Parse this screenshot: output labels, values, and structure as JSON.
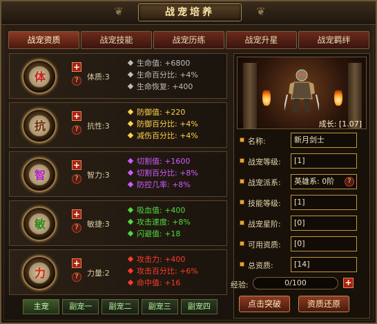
{
  "title": "战宠培养",
  "tabs": [
    "战宠资质",
    "战宠技能",
    "战宠历练",
    "战宠升星",
    "战宠羁绊"
  ],
  "attributes": [
    {
      "char": "体",
      "char_color": "#c8202a",
      "name": "体质:3",
      "stat_color": "#bdbdbd",
      "stats": [
        "生命值: +6800",
        "生命百分比: +4%",
        "生命恢复: +400"
      ]
    },
    {
      "char": "抗",
      "char_color": "#6b2a10",
      "name": "抗性:3",
      "stat_color": "#ffd24a",
      "stats": [
        "防御值: +220",
        "防御百分比: +4%",
        "减伤百分比: +4%"
      ]
    },
    {
      "char": "智",
      "char_color": "#b21fc9",
      "name": "智力:3",
      "stat_color": "#cf5bff",
      "stats": [
        "切割值: +1600",
        "切割百分比: +8%",
        "防控几率: +8%"
      ]
    },
    {
      "char": "敏",
      "char_color": "#2f8a1c",
      "name": "敏捷:3",
      "stat_color": "#4edb3e",
      "stats": [
        "吸血值: +400",
        "攻击速度: +8%",
        "闪避值: +18"
      ]
    },
    {
      "char": "力",
      "char_color": "#d8231b",
      "name": "力量:2",
      "stat_color": "#ff3a2a",
      "stats": [
        "攻击力: +400",
        "攻击百分比: +6%",
        "命中值: +16"
      ]
    }
  ],
  "bottom_tabs": [
    "主宠",
    "副宠一",
    "副宠二",
    "副宠三",
    "副宠四"
  ],
  "growth": "成长: [1.07]",
  "info": [
    {
      "label": "名称:",
      "value": "新月剑士"
    },
    {
      "label": "战宠等级:",
      "value": "[1]"
    },
    {
      "label": "战宠派系:",
      "value": "英雄系: 0阶",
      "help": "?"
    },
    {
      "label": "技能等级:",
      "value": "[1]"
    },
    {
      "label": "战宠星阶:",
      "value": "[0]"
    },
    {
      "label": "可用资质:",
      "value": "[0]"
    },
    {
      "label": "总资质:",
      "value": "[14]"
    }
  ],
  "exp": {
    "label": "经验:",
    "text": "0/100",
    "fraction": 0
  },
  "actions": {
    "breakthrough": "点击突破",
    "reset": "资质还原"
  }
}
